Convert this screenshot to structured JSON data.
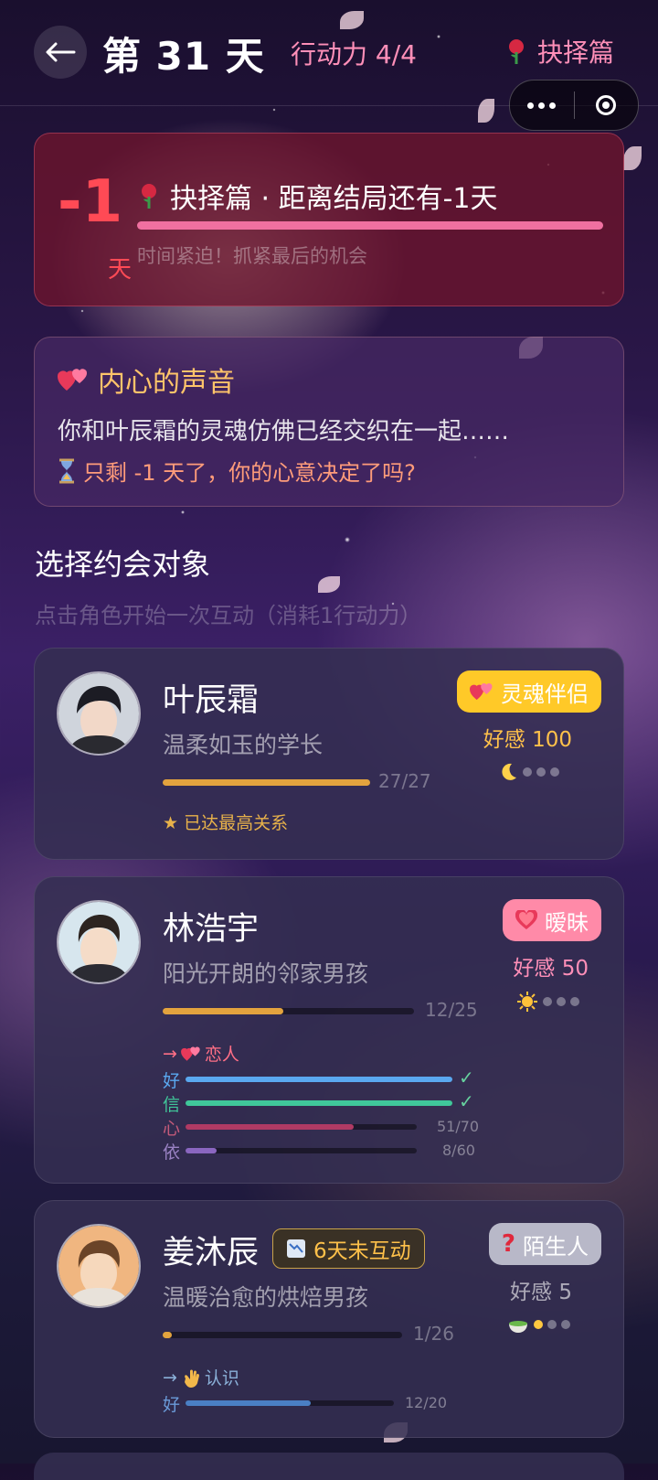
{
  "header": {
    "day_title": "第 31 天",
    "action_points": "行动力 4/4",
    "chapter_icon": "rose-icon",
    "chapter": "抉择篇",
    "capsule_more_icon": "more-dots-icon",
    "capsule_close_icon": "target-circle-icon"
  },
  "countdown": {
    "number": "-1",
    "unit": "天",
    "icon": "rose-icon",
    "title": "抉择篇 · 距离结局还有-1天",
    "subtitle": "时间紧迫！抓紧最后的机会",
    "progress": 1.0
  },
  "inner_voice": {
    "icon": "double-heart-icon",
    "title": "内心的声音",
    "text": "你和叶辰霜的灵魂仿佛已经交织在一起……",
    "question_icon": "hourglass-icon",
    "question": "只剩 -1 天了，你的心意决定了吗?"
  },
  "section": {
    "title": "选择约会对象",
    "subtitle": "点击角色开始一次互动（消耗1行动力）"
  },
  "characters": [
    {
      "name": "叶辰霜",
      "desc": "温柔如玉的学长",
      "badge": "灵魂伴侣",
      "badge_icon": "double-heart-icon",
      "affection": "好感 100",
      "time_icon": "moon-icon",
      "progress_text": "27/27",
      "progress": 1.0,
      "note": "★ 已达最高关系"
    },
    {
      "name": "林浩宇",
      "desc": "阳光开朗的邻家男孩",
      "badge": "暧昧",
      "badge_icon": "heart-icon",
      "affection": "好感 50",
      "time_icon": "sun-icon",
      "progress_text": "12/25",
      "progress": 0.48,
      "next_arrow": "→",
      "next_icon": "double-heart-icon",
      "next_label": "恋人",
      "stats": [
        {
          "label": "好",
          "value": "",
          "fill": 1.0,
          "color": "#5aa8f0",
          "done": true
        },
        {
          "label": "信",
          "value": "",
          "fill": 1.0,
          "color": "#40c79a",
          "done": true
        },
        {
          "label": "心",
          "value": "51/70",
          "fill": 0.7286,
          "color": "#b03a64",
          "done": false
        },
        {
          "label": "依",
          "value": "8/60",
          "fill": 0.1333,
          "color": "#8a66c0",
          "done": false
        }
      ]
    },
    {
      "name": "姜沐辰",
      "desc": "温暖治愈的烘焙男孩",
      "tag": "6天未互动",
      "tag_icon": "chart-down-icon",
      "badge": "陌生人",
      "badge_icon": "question-icon",
      "affection": "好感 5",
      "time_icon": "tea-bowl-icon",
      "progress_text": "1/26",
      "progress": 0.038,
      "next_arrow": "→",
      "next_icon": "wave-hand-icon",
      "next_label": "认识",
      "stats": [
        {
          "label": "好",
          "value": "12/20",
          "fill": 0.6,
          "color": "#4a7fc4",
          "done": false
        }
      ]
    }
  ],
  "colors": {
    "accent_pink": "#ff8fb8",
    "countdown_red": "#ff4a55",
    "gold": "#e3a33e",
    "soul_badge": "#ffc928",
    "ambiguous_badge": "#ff8aa8",
    "stranger_badge": "#b8b8c8"
  }
}
